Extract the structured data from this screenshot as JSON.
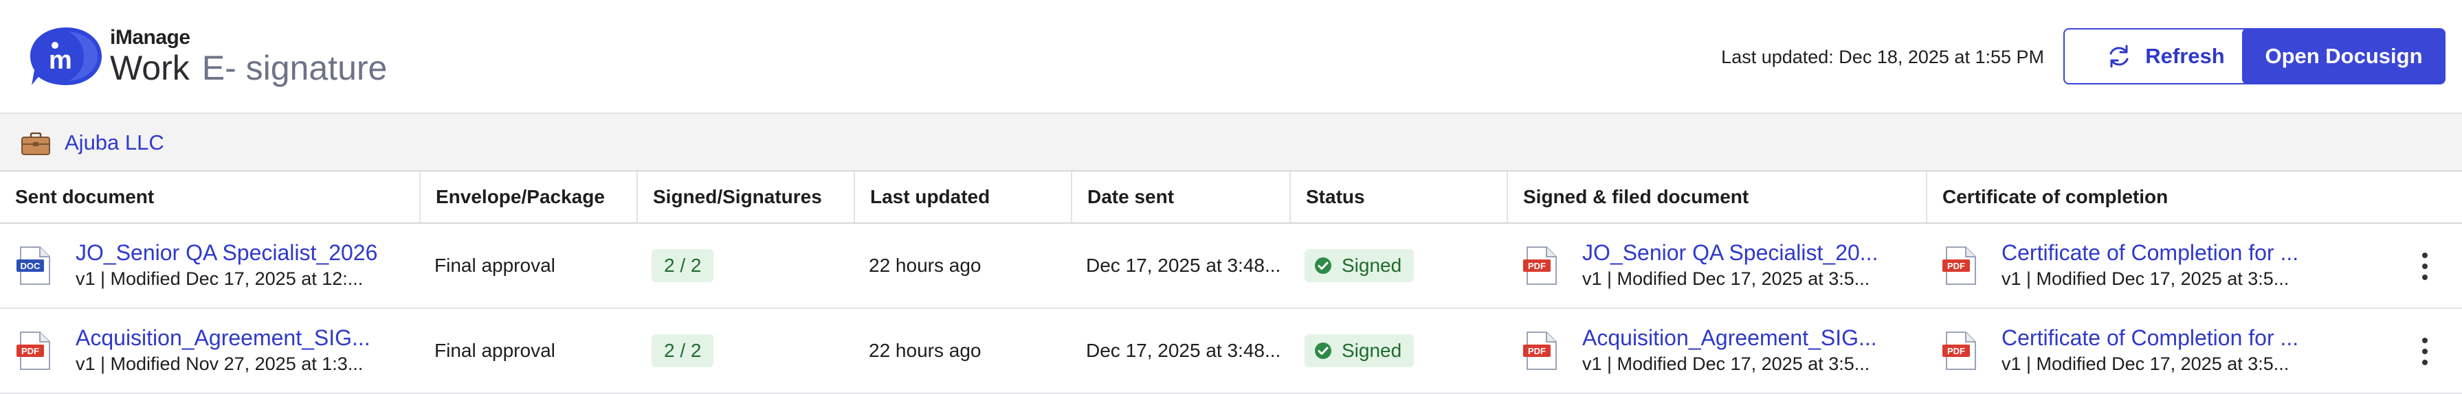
{
  "app": {
    "brand_top": "iManage",
    "brand_work": "Work",
    "brand_esig": "E- signature"
  },
  "header": {
    "last_updated": "Last updated: Dec 18, 2025 at 1:55 PM",
    "refresh_label": "Refresh",
    "open_docusign_label": "Open Docusign"
  },
  "client": {
    "name": "Ajuba LLC"
  },
  "table": {
    "columns": [
      "Sent document",
      "Envelope/Package",
      "Signed/Signatures",
      "Last updated",
      "Date sent",
      "Status",
      "Signed & filed document",
      "Certificate of completion"
    ],
    "rows": [
      {
        "sent_icon": "DOC",
        "sent_title": "JO_Senior QA Specialist_2026",
        "sent_meta": "v1 | Modified Dec 17, 2025 at 12:...",
        "envelope": "Final approval",
        "signatures": "2 / 2",
        "last_updated": "22 hours ago",
        "date_sent": "Dec 17, 2025 at 3:48...",
        "status": "Signed",
        "filed_title": "JO_Senior QA Specialist_20...",
        "filed_meta": "v1 | Modified Dec 17, 2025 at 3:5...",
        "cert_title": "Certificate of Completion for ...",
        "cert_meta": "v1 | Modified Dec 17, 2025 at 3:5..."
      },
      {
        "sent_icon": "PDF",
        "sent_title": "Acquisition_Agreement_SIG...",
        "sent_meta": "v1 | Modified Nov 27, 2025 at 1:3...",
        "envelope": "Final approval",
        "signatures": "2 / 2",
        "last_updated": "22 hours ago",
        "date_sent": "Dec 17, 2025 at 3:48...",
        "status": "Signed",
        "filed_title": "Acquisition_Agreement_SIG...",
        "filed_meta": "v1 | Modified Dec 17, 2025 at 3:5...",
        "cert_title": "Certificate of Completion for ...",
        "cert_meta": "v1 | Modified Dec 17, 2025 at 3:5..."
      }
    ]
  },
  "icons": {
    "logo": "imanage-logo-icon",
    "refresh": "refresh-icon",
    "client": "briefcase-icon",
    "doc": "doc-file-icon",
    "pdf": "pdf-file-icon",
    "status": "check-circle-icon",
    "more": "more-vertical-icon"
  },
  "colors": {
    "accent": "#3a46d6",
    "link": "#2f39c9",
    "success_bg": "#e3f4e6",
    "success_fg": "#1f6b2e",
    "pdf_red": "#d93a2e",
    "doc_blue": "#2b4fb8"
  }
}
